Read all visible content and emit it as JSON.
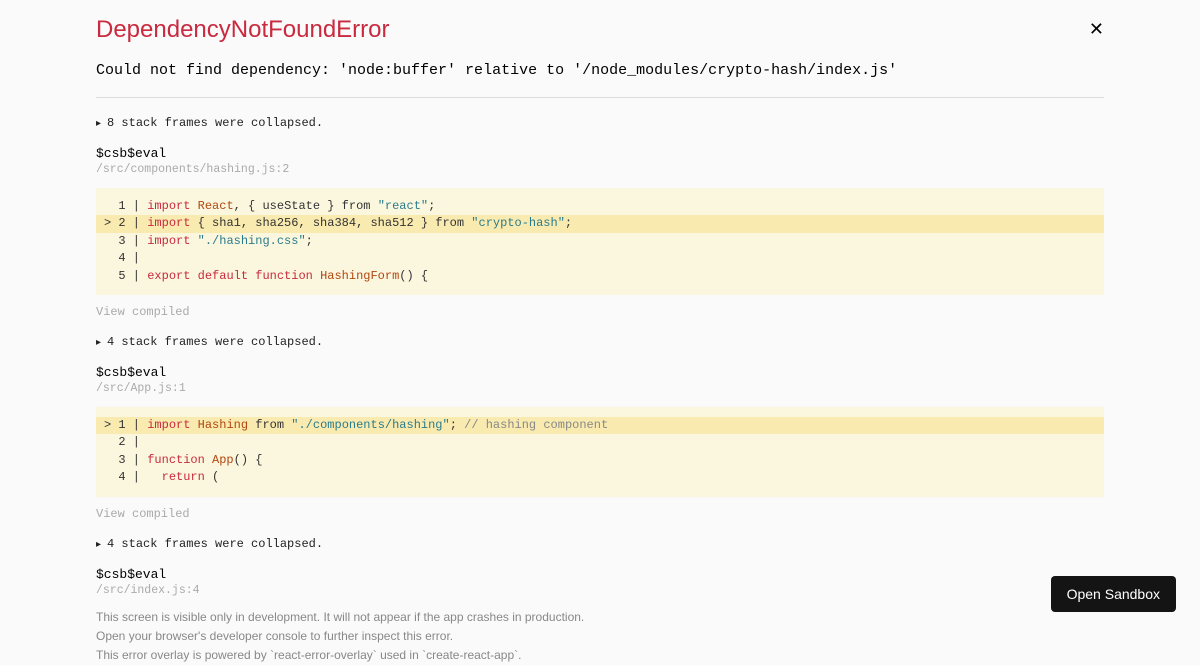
{
  "error": {
    "title": "DependencyNotFoundError",
    "message": "Could not find dependency: 'node:buffer' relative to '/node_modules/crypto-hash/index.js'"
  },
  "frames": [
    {
      "collapsed": "8 stack frames were collapsed.",
      "name": "$csb$eval",
      "loc": "/src/components/hashing.js:2",
      "code": {
        "lines": [
          {
            "n": "1",
            "hl": false,
            "tokens": [
              {
                "t": "import ",
                "c": "kw"
              },
              {
                "t": "React",
                "c": "id"
              },
              {
                "t": ", { ",
                "c": "punc"
              },
              {
                "t": "useState",
                "c": "punc"
              },
              {
                "t": " } from ",
                "c": "punc"
              },
              {
                "t": "\"react\"",
                "c": "str"
              },
              {
                "t": ";",
                "c": "punc"
              }
            ]
          },
          {
            "n": "2",
            "hl": true,
            "tokens": [
              {
                "t": "import ",
                "c": "kw"
              },
              {
                "t": "{ sha1, sha256, sha384, sha512 } from ",
                "c": "punc"
              },
              {
                "t": "\"crypto-hash\"",
                "c": "str"
              },
              {
                "t": ";",
                "c": "punc"
              }
            ]
          },
          {
            "n": "3",
            "hl": false,
            "tokens": [
              {
                "t": "import ",
                "c": "kw"
              },
              {
                "t": "\"./hashing.css\"",
                "c": "str"
              },
              {
                "t": ";",
                "c": "punc"
              }
            ]
          },
          {
            "n": "4",
            "hl": false,
            "tokens": []
          },
          {
            "n": "5",
            "hl": false,
            "tokens": [
              {
                "t": "export ",
                "c": "kw"
              },
              {
                "t": "default ",
                "c": "kw"
              },
              {
                "t": "function ",
                "c": "kw"
              },
              {
                "t": "HashingForm",
                "c": "id"
              },
              {
                "t": "() {",
                "c": "punc"
              }
            ]
          }
        ]
      },
      "view_compiled": "View compiled"
    },
    {
      "collapsed": "4 stack frames were collapsed.",
      "name": "$csb$eval",
      "loc": "/src/App.js:1",
      "code": {
        "lines": [
          {
            "n": "1",
            "hl": true,
            "tokens": [
              {
                "t": "import ",
                "c": "kw"
              },
              {
                "t": "Hashing",
                "c": "id"
              },
              {
                "t": " from ",
                "c": "punc"
              },
              {
                "t": "\"./components/hashing\"",
                "c": "str"
              },
              {
                "t": "; ",
                "c": "punc"
              },
              {
                "t": "// hashing component",
                "c": "cmt"
              }
            ]
          },
          {
            "n": "2",
            "hl": false,
            "tokens": []
          },
          {
            "n": "3",
            "hl": false,
            "tokens": [
              {
                "t": "function ",
                "c": "kw"
              },
              {
                "t": "App",
                "c": "id"
              },
              {
                "t": "() {",
                "c": "punc"
              }
            ]
          },
          {
            "n": "4",
            "hl": false,
            "tokens": [
              {
                "t": "  ",
                "c": "punc"
              },
              {
                "t": "return ",
                "c": "kw"
              },
              {
                "t": "(",
                "c": "punc"
              }
            ]
          }
        ]
      },
      "view_compiled": "View compiled"
    },
    {
      "collapsed": "4 stack frames were collapsed.",
      "name": "$csb$eval",
      "loc": "/src/index.js:4"
    }
  ],
  "footer": {
    "l1": "This screen is visible only in development. It will not appear if the app crashes in production.",
    "l2": "Open your browser's developer console to further inspect this error.",
    "l3": "This error overlay is powered by `react-error-overlay` used in `create-react-app`."
  },
  "button": {
    "open_sandbox": "Open Sandbox"
  }
}
